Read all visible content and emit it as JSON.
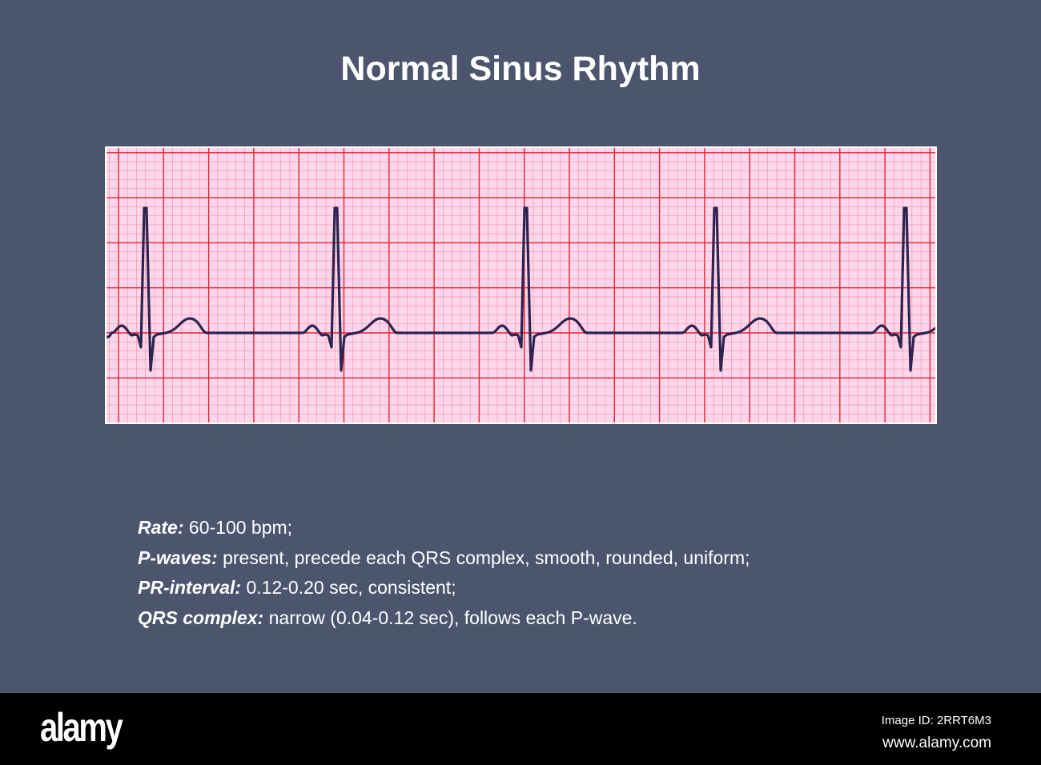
{
  "title": "Normal Sinus Rhythm",
  "criteria": [
    {
      "label": "Rate:",
      "text": " 60-100 bpm;"
    },
    {
      "label": "P-waves:",
      "text": " present, precede each QRS complex, smooth, rounded, uniform;"
    },
    {
      "label": "PR-interval:",
      "text": " 0.12-0.20 sec, consistent;"
    },
    {
      "label": "QRS complex:",
      "text": " narrow (0.04-0.12 sec), follows each P-wave."
    }
  ],
  "footer": {
    "logo": "alamy",
    "image_id": "Image ID: 2RRT6M3",
    "site": "www.alamy.com"
  },
  "colors": {
    "background": "#4b566e",
    "paper": "#fdd6ec",
    "grid_major": "#e8202c",
    "grid_minor": "#e87080",
    "trace": "#2c2450"
  },
  "ecg": {
    "beats": 5
  }
}
